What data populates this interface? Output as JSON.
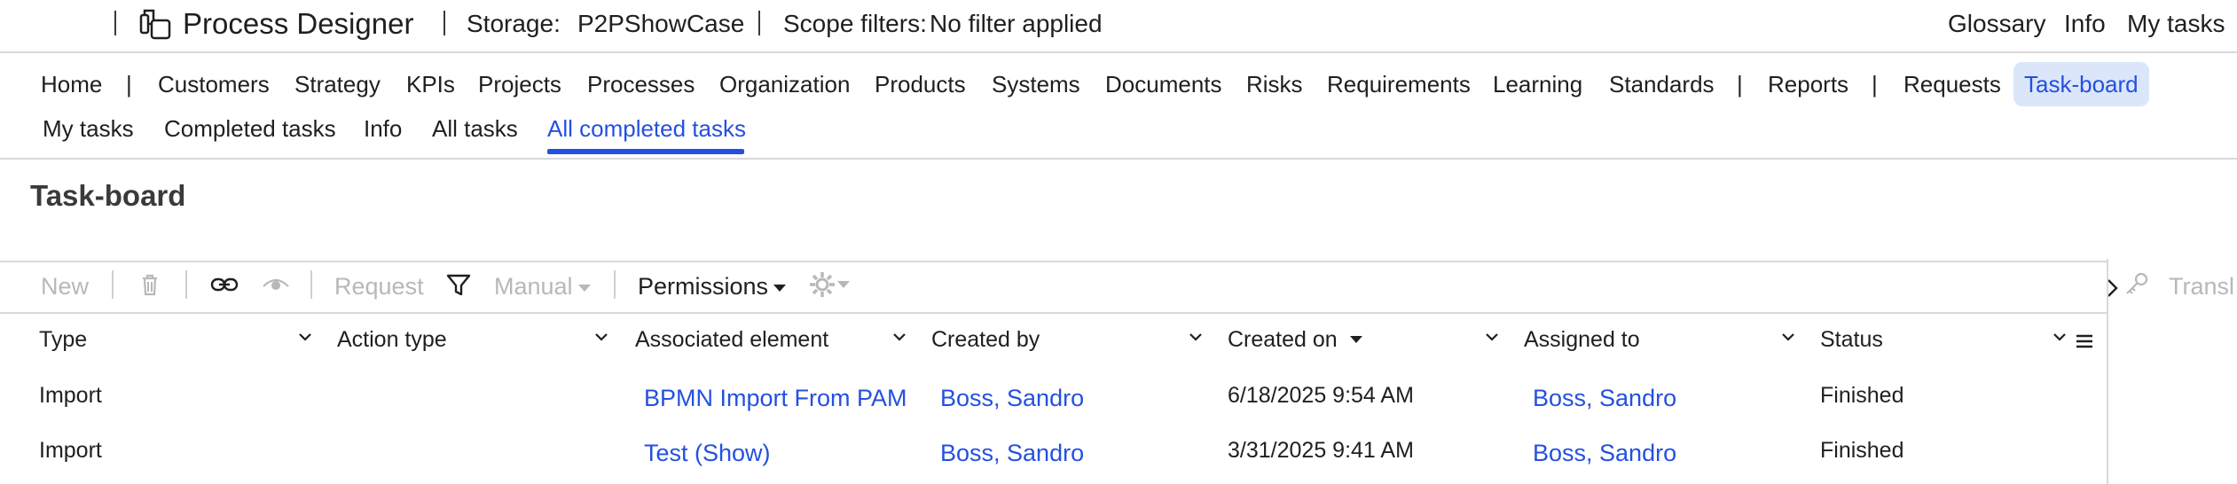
{
  "header": {
    "app_title": "Process Designer",
    "storage_label": "Storage:",
    "storage_value": "P2PShowCase",
    "scope_label": "Scope filters:",
    "scope_value": "No filter applied",
    "links": [
      "Glossary",
      "Info",
      "My tasks"
    ]
  },
  "nav": {
    "items": [
      "Home",
      "Customers",
      "Strategy",
      "KPIs",
      "Projects",
      "Processes",
      "Organization",
      "Products",
      "Systems",
      "Documents",
      "Risks",
      "Requirements",
      "Learning",
      "Standards",
      "Reports",
      "Requests",
      "Task-board"
    ],
    "separator": "|",
    "active": "Task-board"
  },
  "subnav": {
    "items": [
      "My tasks",
      "Completed tasks",
      "Info",
      "All tasks",
      "All completed tasks"
    ],
    "active": "All completed tasks"
  },
  "page": {
    "title": "Task-board"
  },
  "toolbar": {
    "new": "New",
    "request": "Request",
    "manual": "Manual",
    "permissions": "Permissions",
    "translate": "Transl"
  },
  "table": {
    "columns": [
      "Type",
      "Action type",
      "Associated element",
      "Created by",
      "Created on",
      "Assigned to",
      "Status"
    ],
    "rows": [
      {
        "type": "Import",
        "action_type": "",
        "associated_element": "BPMN Import From PAM",
        "created_by": "Boss, Sandro",
        "created_on": "6/18/2025 9:54 AM",
        "assigned_to": "Boss, Sandro",
        "status": "Finished"
      },
      {
        "type": "Import",
        "action_type": "",
        "associated_element": "Test (Show)",
        "created_by": "Boss, Sandro",
        "created_on": "3/31/2025 9:41 AM",
        "assigned_to": "Boss, Sandro",
        "status": "Finished"
      }
    ]
  },
  "colors": {
    "accent": "#2450e0",
    "active_bg": "#dbe6fb",
    "disabled": "#b8b8b8"
  }
}
